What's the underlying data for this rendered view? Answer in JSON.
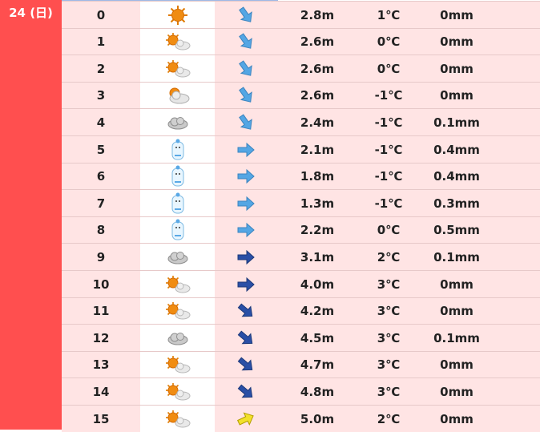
{
  "day_label": "24 (日)",
  "colors": {
    "date_bg": "#ff4f4f",
    "row_bg": "#ffe4e4",
    "arrow_light": "#54a6e4",
    "arrow_dark": "#2a4fa6",
    "arrow_yellow": "#f2e12b"
  },
  "rows": [
    {
      "hour": "0",
      "weather_icon": "sun-icon",
      "wind_dir_icon": "arrow-southeast-light-icon",
      "wind": "2.8m",
      "temp": "1℃",
      "precip": "0mm"
    },
    {
      "hour": "1",
      "weather_icon": "sun-cloud-icon",
      "wind_dir_icon": "arrow-southeast-light-icon",
      "wind": "2.6m",
      "temp": "0℃",
      "precip": "0mm"
    },
    {
      "hour": "2",
      "weather_icon": "sun-cloud-icon",
      "wind_dir_icon": "arrow-southeast-light-icon",
      "wind": "2.6m",
      "temp": "0℃",
      "precip": "0mm"
    },
    {
      "hour": "3",
      "weather_icon": "cloud-sun-icon",
      "wind_dir_icon": "arrow-southeast-light-icon",
      "wind": "2.6m",
      "temp": "-1℃",
      "precip": "0mm"
    },
    {
      "hour": "4",
      "weather_icon": "cloud-icon",
      "wind_dir_icon": "arrow-southeast-light-icon",
      "wind": "2.4m",
      "temp": "-1℃",
      "precip": "0.1mm"
    },
    {
      "hour": "5",
      "weather_icon": "snowman-icon",
      "wind_dir_icon": "arrow-east-light-icon",
      "wind": "2.1m",
      "temp": "-1℃",
      "precip": "0.4mm"
    },
    {
      "hour": "6",
      "weather_icon": "snowman-icon",
      "wind_dir_icon": "arrow-east-light-icon",
      "wind": "1.8m",
      "temp": "-1℃",
      "precip": "0.4mm"
    },
    {
      "hour": "7",
      "weather_icon": "snowman-icon",
      "wind_dir_icon": "arrow-east-light-icon",
      "wind": "1.3m",
      "temp": "-1℃",
      "precip": "0.3mm"
    },
    {
      "hour": "8",
      "weather_icon": "snowman-icon",
      "wind_dir_icon": "arrow-east-light-icon",
      "wind": "2.2m",
      "temp": "0℃",
      "precip": "0.5mm"
    },
    {
      "hour": "9",
      "weather_icon": "cloud-icon",
      "wind_dir_icon": "arrow-east-dark-icon",
      "wind": "3.1m",
      "temp": "2℃",
      "precip": "0.1mm"
    },
    {
      "hour": "10",
      "weather_icon": "sun-cloud-icon",
      "wind_dir_icon": "arrow-east-dark-icon",
      "wind": "4.0m",
      "temp": "3℃",
      "precip": "0mm"
    },
    {
      "hour": "11",
      "weather_icon": "sun-cloud-icon",
      "wind_dir_icon": "arrow-southeast-dark-icon",
      "wind": "4.2m",
      "temp": "3℃",
      "precip": "0mm"
    },
    {
      "hour": "12",
      "weather_icon": "cloud-icon",
      "wind_dir_icon": "arrow-southeast-dark-icon",
      "wind": "4.5m",
      "temp": "3℃",
      "precip": "0.1mm"
    },
    {
      "hour": "13",
      "weather_icon": "sun-cloud-icon",
      "wind_dir_icon": "arrow-southeast-dark-icon",
      "wind": "4.7m",
      "temp": "3℃",
      "precip": "0mm"
    },
    {
      "hour": "14",
      "weather_icon": "sun-cloud-icon",
      "wind_dir_icon": "arrow-southeast-dark-icon",
      "wind": "4.8m",
      "temp": "3℃",
      "precip": "0mm"
    },
    {
      "hour": "15",
      "weather_icon": "sun-cloud-icon",
      "wind_dir_icon": "arrow-northeast-yellow-icon",
      "wind": "5.0m",
      "temp": "2℃",
      "precip": "0mm"
    }
  ]
}
